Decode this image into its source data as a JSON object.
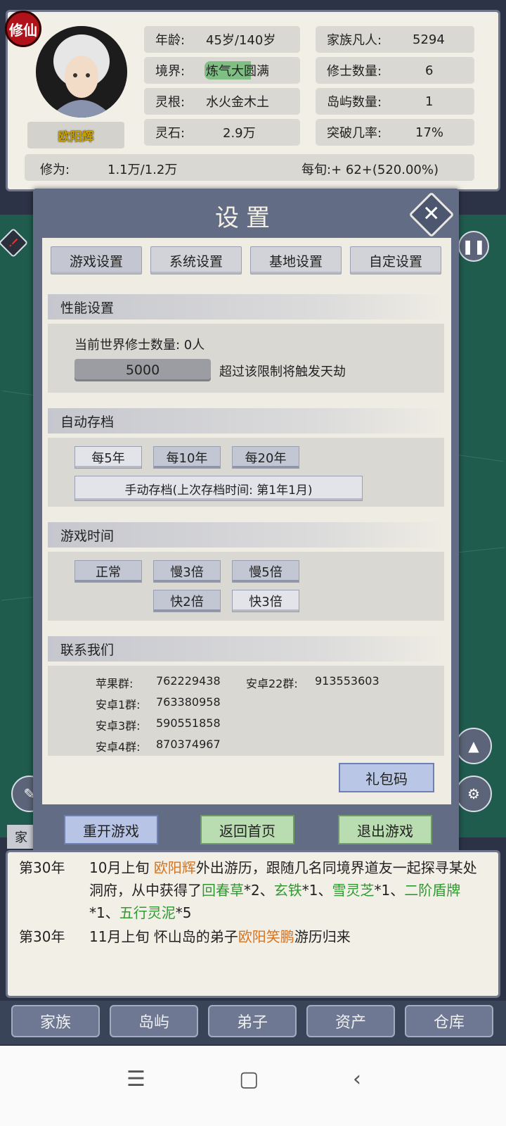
{
  "status": {
    "badge": "修仙",
    "name": "欧阳辉",
    "age_label": "年龄:",
    "age_value": "45岁/140岁",
    "realm_label": "境界:",
    "realm_value": "炼气大圆满",
    "root_label": "灵根:",
    "root_value": "水火金木土",
    "stone_label": "灵石:",
    "stone_value": "2.9万",
    "family_label": "家族凡人:",
    "family_value": "5294",
    "cultivator_label": "修士数量:",
    "cultivator_value": "6",
    "island_label": "岛屿数量:",
    "island_value": "1",
    "breakthrough_label": "突破几率:",
    "breakthrough_value": "17%",
    "cultivation_label": "修为:",
    "cultivation_value": "1.1万/1.2万",
    "per_period": "每旬:+ 62+(520.00%)"
  },
  "modal": {
    "title": "设置",
    "tabs": [
      "游戏设置",
      "系统设置",
      "基地设置",
      "自定设置"
    ],
    "performance": {
      "header": "性能设置",
      "current_label": "当前世界修士数量: 0人",
      "limit_value": "5000",
      "limit_note": "超过该限制将触发天劫"
    },
    "autosave": {
      "header": "自动存档",
      "options": [
        "每5年",
        "每10年",
        "每20年"
      ],
      "manual": "手动存档(上次存档时间: 第1年1月)"
    },
    "game_time": {
      "header": "游戏时间",
      "options": [
        "正常",
        "慢3倍",
        "慢5倍",
        "快2倍",
        "快3倍"
      ]
    },
    "contact": {
      "header": "联系我们",
      "rows": [
        {
          "label": "苹果群:",
          "value": "762229438"
        },
        {
          "label": "安卓22群:",
          "value": "913553603"
        },
        {
          "label": "安卓1群:",
          "value": "763380958"
        },
        {
          "label": "安卓3群:",
          "value": "590551858"
        },
        {
          "label": "安卓4群:",
          "value": "870374967"
        }
      ]
    },
    "gift_button": "礼包码",
    "footer_buttons": [
      "重开游戏",
      "返回首页",
      "退出游戏"
    ]
  },
  "log": {
    "e1_year": "第30年",
    "e1_a": "10月上旬 ",
    "e1_name": "欧阳辉",
    "e1_b": "外出游历，跟随几名同境界道友一起探寻某处洞府，从中获得了",
    "e1_i1": "回春草",
    "e1_c1": "*2、",
    "e1_i2": "玄铁",
    "e1_c2": "*1、",
    "e1_i3": "雪灵芝",
    "e1_c3": "*1、",
    "e1_i4": "二阶盾牌",
    "e1_c4": "*1、",
    "e1_i5": "五行灵泥",
    "e1_c5": "*5",
    "e2_year": "第30年",
    "e2_a": "11月上旬 怀山岛的弟子",
    "e2_name": "欧阳笑鹏",
    "e2_b": "游历归来"
  },
  "partial_tab": "家",
  "bottom_nav": [
    "家族",
    "岛屿",
    "弟子",
    "资产",
    "仓库"
  ],
  "colors": {
    "highlight_name": "#d6731f",
    "highlight_item": "#2f9a30",
    "modal_frame": "#636c85"
  }
}
